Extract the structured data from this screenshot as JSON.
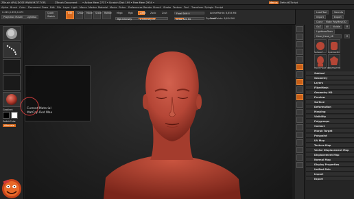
{
  "titlebar": {
    "left": "ZBrush 4R4 [DOSE WWW.MZIT.TOP]",
    "doc": "ZBrush Document",
    "mem": "• Active Mem 2737 • Scratch Disk 199 • Free Mem 2934 •",
    "menus_label": "Menus",
    "script_label": "DefaultZScript"
  },
  "menubar": [
    "Alpha",
    "Brush",
    "Color",
    "Document",
    "Draw",
    "Edit",
    "File",
    "Layer",
    "Light",
    "Macro",
    "Marker",
    "Material",
    "Movie",
    "Picker",
    "Preferences",
    "Render",
    "Stencil",
    "Stroke",
    "Texture",
    "Tool",
    "Transform",
    "Zplugin",
    "Zscript"
  ],
  "topshelf": {
    "coords": "0.415,0.339,0.473",
    "projection_master": "Projection Master",
    "lightbox": "LightBox",
    "quick_sketch": "Quick Sketch",
    "edit": "Edit",
    "draw": "Draw",
    "move": "Move",
    "scale": "Scale",
    "rotate": "Rotate",
    "mrgb": "Mrgb",
    "rgb": "Rgb",
    "m": "M",
    "rgb_intensity": "Rgb Intensity",
    "zadd": "Zadd",
    "zsub": "Zsub",
    "zcut": "Zcut",
    "z_intensity": "Z Intensity 25",
    "focal_shift": "Focal Shift 0",
    "draw_size": "Draw Size 64",
    "dynamic": "Dynamic",
    "active_points": "ActivePoints: 6,654 Mil",
    "total_points": "TotalPoints: 6,654 Mil"
  },
  "tray": {
    "load_tool": "Load Tool",
    "save_as": "Save As",
    "import": "Import",
    "export": "Export",
    "clone": "Clone",
    "make_polymesh3d": "Make PolyMesh3D",
    "goz": "GoZ",
    "all": "All",
    "visible": "Visible",
    "r": "R",
    "lightbox_tools": "Lightbox▸Tools",
    "tool_name": "Head_Head_48",
    "r2": "R",
    "thumb_labels": [
      "SphereF",
      "Cylinder3D",
      "Head_Head_48",
      "PolyMesh3D"
    ]
  },
  "tool_menu": [
    "Subtool",
    "Geometry",
    "Layers",
    "FiberMesh",
    "Geometry HD",
    "Preview",
    "Surface",
    "Deformation",
    "Masking",
    "Visibility",
    "Polygroups",
    "Contact",
    "Morph Target",
    "Polypaint",
    "UV Map",
    "Texture Map",
    "Vector Displacement Map",
    "Displacement Map",
    "Normal Map",
    "Display Properties",
    "Unified Skin",
    "Import",
    "Export"
  ],
  "left_labels": {
    "gradient": "Gradient",
    "switch_color": "SwitchColor",
    "alternate": "Alternate"
  },
  "material_tip": {
    "line1": "Current Material",
    "line2": "MatCap Red Wax"
  },
  "colors": {
    "accent": "#f07a1a",
    "wax": "#c04a3a"
  }
}
